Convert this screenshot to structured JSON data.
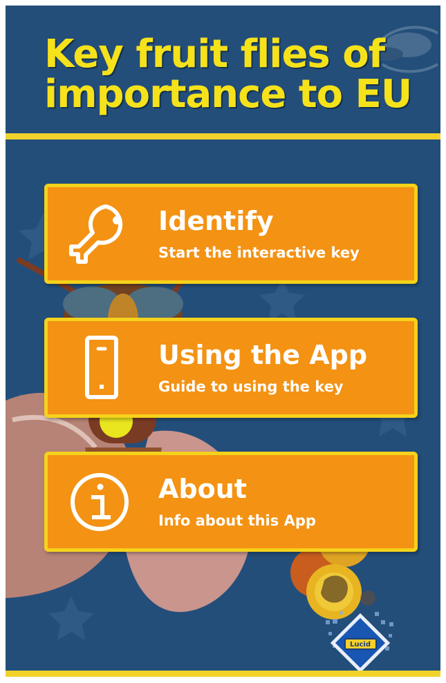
{
  "app": {
    "title_lines": [
      "Key fruit flies of",
      "importance to EU"
    ]
  },
  "menu": {
    "items": [
      {
        "title": "Identify",
        "subtitle": "Start the interactive key",
        "icon": "key-icon"
      },
      {
        "title": "Using the App",
        "subtitle": "Guide to using the key",
        "icon": "tablet-icon"
      },
      {
        "title": "About",
        "subtitle": "Info about this App",
        "icon": "info-icon"
      }
    ]
  },
  "logo": {
    "label": "Lucid"
  },
  "colors": {
    "background": "#234e7a",
    "title": "#f6e21b",
    "button": "#f49213",
    "button_border": "#f5d21b",
    "text": "#ffffff"
  }
}
